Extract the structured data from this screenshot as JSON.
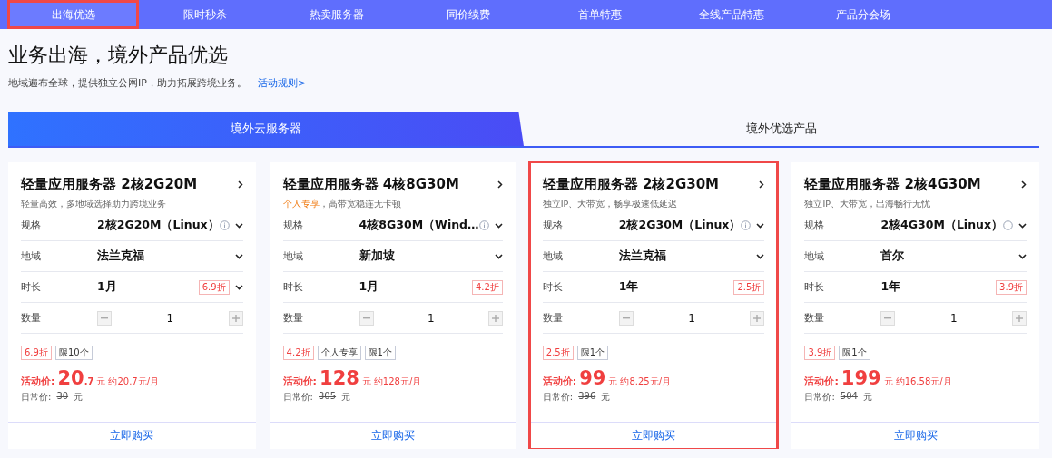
{
  "nav": [
    {
      "label": "出海优选",
      "selected": true,
      "highlighted": true
    },
    {
      "label": "限时秒杀",
      "selected": false,
      "highlighted": false
    },
    {
      "label": "热卖服务器",
      "selected": false,
      "highlighted": false
    },
    {
      "label": "同价续费",
      "selected": false,
      "highlighted": false
    },
    {
      "label": "首单特惠",
      "selected": false,
      "highlighted": false
    },
    {
      "label": "全线产品特惠",
      "selected": false,
      "highlighted": false
    },
    {
      "label": "产品分会场",
      "selected": false,
      "highlighted": false
    }
  ],
  "heading": "业务出海，境外产品优选",
  "intro": "地域遍布全球，提供独立公网IP，助力拓展跨境业务。",
  "rules_link": "活动规则>",
  "tabs": [
    {
      "label": "境外云服务器",
      "selected": true
    },
    {
      "label": "境外优选产品",
      "selected": false
    }
  ],
  "cards": [
    {
      "title": "轻量应用服务器 2核2G20M",
      "highlighted": false,
      "subtitle": "轻量高效，多地域选择助力跨境业务",
      "rows": [
        {
          "kind": "select",
          "label": "规格",
          "value": "2核2G20M（Linux）",
          "info": true,
          "dropdown": true
        },
        {
          "kind": "select",
          "label": "地域",
          "value": "法兰克福",
          "info": false,
          "dropdown": true
        },
        {
          "kind": "select",
          "label": "时长",
          "value": "1月",
          "info": false,
          "dropdown": true,
          "discount": "6.9折"
        },
        {
          "kind": "stepper",
          "label": "数量",
          "value": "1"
        }
      ],
      "tags": [
        {
          "kind": "discount",
          "text": "6.9折"
        },
        {
          "kind": "plain",
          "text": "限10个"
        }
      ],
      "price_label": "活动价:",
      "price_int": "20",
      "price_dec": ".7",
      "price_unit": "元",
      "monthly": "约20.7元/月",
      "regular_label": "日常价:",
      "regular_price": "30",
      "regular_unit": "元",
      "buy": "立即购买"
    },
    {
      "title": "轻量应用服务器 4核8G30M",
      "highlighted": false,
      "subtitle_highlight": "个人专享",
      "subtitle": "，高带宽稳连无卡顿",
      "rows": [
        {
          "kind": "select",
          "label": "规格",
          "value": "4核8G30M（Wind…",
          "info": true,
          "dropdown": true
        },
        {
          "kind": "select",
          "label": "地域",
          "value": "新加坡",
          "info": false,
          "dropdown": true
        },
        {
          "kind": "select",
          "label": "时长",
          "value": "1月",
          "info": false,
          "dropdown": false,
          "discount": "4.2折"
        },
        {
          "kind": "stepper",
          "label": "数量",
          "value": "1"
        }
      ],
      "tags": [
        {
          "kind": "discount",
          "text": "4.2折"
        },
        {
          "kind": "plain",
          "text": "个人专享"
        },
        {
          "kind": "plain",
          "text": "限1个"
        }
      ],
      "price_label": "活动价:",
      "price_int": "128",
      "price_unit": "元",
      "monthly": "约128元/月",
      "regular_label": "日常价:",
      "regular_price": "305",
      "regular_unit": "元",
      "buy": "立即购买"
    },
    {
      "title": "轻量应用服务器 2核2G30M",
      "highlighted": true,
      "subtitle": "独立IP、大带宽，畅享极速低延迟",
      "rows": [
        {
          "kind": "select",
          "label": "规格",
          "value": "2核2G30M（Linux）",
          "info": true,
          "dropdown": true
        },
        {
          "kind": "select",
          "label": "地域",
          "value": "法兰克福",
          "info": false,
          "dropdown": true
        },
        {
          "kind": "select",
          "label": "时长",
          "value": "1年",
          "info": false,
          "dropdown": false,
          "discount": "2.5折"
        },
        {
          "kind": "stepper",
          "label": "数量",
          "value": "1"
        }
      ],
      "tags": [
        {
          "kind": "discount",
          "text": "2.5折"
        },
        {
          "kind": "plain",
          "text": "限1个"
        }
      ],
      "price_label": "活动价:",
      "price_int": "99",
      "price_unit": "元",
      "monthly": "约8.25元/月",
      "regular_label": "日常价:",
      "regular_price": "396",
      "regular_unit": "元",
      "buy": "立即购买"
    },
    {
      "title": "轻量应用服务器 2核4G30M",
      "highlighted": false,
      "subtitle": "独立IP、大带宽，出海畅行无忧",
      "rows": [
        {
          "kind": "select",
          "label": "规格",
          "value": "2核4G30M（Linux）",
          "info": true,
          "dropdown": true
        },
        {
          "kind": "select",
          "label": "地域",
          "value": "首尔",
          "info": false,
          "dropdown": true
        },
        {
          "kind": "select",
          "label": "时长",
          "value": "1年",
          "info": false,
          "dropdown": false,
          "discount": "3.9折"
        },
        {
          "kind": "stepper",
          "label": "数量",
          "value": "1"
        }
      ],
      "tags": [
        {
          "kind": "discount",
          "text": "3.9折"
        },
        {
          "kind": "plain",
          "text": "限1个"
        }
      ],
      "price_label": "活动价:",
      "price_int": "199",
      "price_unit": "元",
      "monthly": "约16.58元/月",
      "regular_label": "日常价:",
      "regular_price": "504",
      "regular_unit": "元",
      "buy": "立即购买"
    }
  ]
}
